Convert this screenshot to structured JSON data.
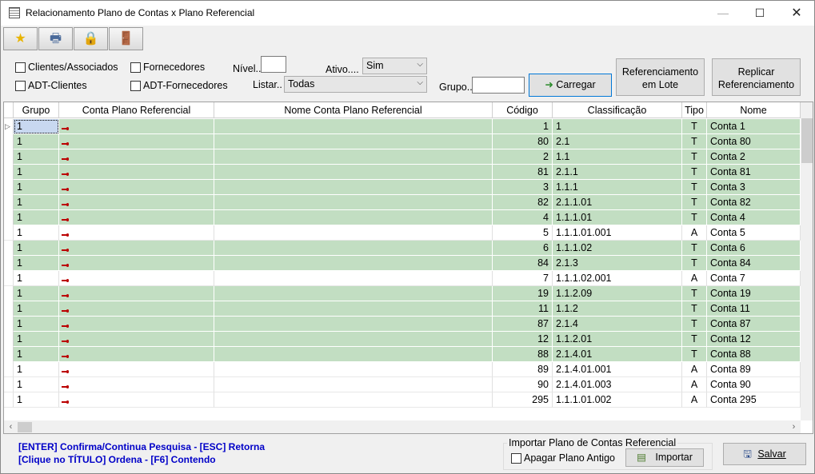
{
  "window": {
    "title": "Relacionamento Plano de Contas x Plano Referencial",
    "minimize": "—",
    "maximize": "☐",
    "close": "✕"
  },
  "toolbar": {
    "buttons": [
      {
        "icon": "star-icon",
        "glyph": "★"
      },
      {
        "icon": "printer-icon",
        "glyph": "🖶"
      },
      {
        "icon": "lock-icon",
        "glyph": "🔒"
      },
      {
        "icon": "exit-door-icon",
        "glyph": "🚪"
      }
    ]
  },
  "filters": {
    "clientes_associados": "Clientes/Associados",
    "fornecedores": "Fornecedores",
    "adt_clientes": "ADT-Clientes",
    "adt_fornecedores": "ADT-Fornecedores",
    "nivel_label": "Nível..",
    "nivel_value": "",
    "ativo_label": "Ativo....",
    "ativo_value": "Sim",
    "listar_label": "Listar..",
    "listar_value": "Todas",
    "grupo_label": "Grupo..",
    "grupo_value": "",
    "carregar_label": "Carregar",
    "ref_lote_line1": "Referenciamento",
    "ref_lote_line2": "em Lote",
    "replicar_line1": "Replicar",
    "replicar_line2": "Referenciamento"
  },
  "grid": {
    "columns": [
      "Grupo",
      "Conta Plano Referencial",
      "Nome Conta Plano Referencial",
      "Código",
      "Classificação",
      "Tipo",
      "Nome"
    ],
    "rows": [
      {
        "grupo": "1",
        "codigo": "1",
        "classificacao": "1",
        "tipo": "T",
        "nome": "Conta 1",
        "style": "green"
      },
      {
        "grupo": "1",
        "codigo": "80",
        "classificacao": "2.1",
        "tipo": "T",
        "nome": "Conta 80",
        "style": "green"
      },
      {
        "grupo": "1",
        "codigo": "2",
        "classificacao": "1.1",
        "tipo": "T",
        "nome": "Conta 2",
        "style": "green"
      },
      {
        "grupo": "1",
        "codigo": "81",
        "classificacao": "2.1.1",
        "tipo": "T",
        "nome": "Conta 81",
        "style": "green"
      },
      {
        "grupo": "1",
        "codigo": "3",
        "classificacao": "1.1.1",
        "tipo": "T",
        "nome": "Conta 3",
        "style": "green"
      },
      {
        "grupo": "1",
        "codigo": "82",
        "classificacao": "2.1.1.01",
        "tipo": "T",
        "nome": "Conta 82",
        "style": "green"
      },
      {
        "grupo": "1",
        "codigo": "4",
        "classificacao": "1.1.1.01",
        "tipo": "T",
        "nome": "Conta 4",
        "style": "green"
      },
      {
        "grupo": "1",
        "codigo": "5",
        "classificacao": "1.1.1.01.001",
        "tipo": "A",
        "nome": "Conta 5",
        "style": "white"
      },
      {
        "grupo": "1",
        "codigo": "6",
        "classificacao": "1.1.1.02",
        "tipo": "T",
        "nome": "Conta 6",
        "style": "green"
      },
      {
        "grupo": "1",
        "codigo": "84",
        "classificacao": "2.1.3",
        "tipo": "T",
        "nome": "Conta 84",
        "style": "green"
      },
      {
        "grupo": "1",
        "codigo": "7",
        "classificacao": "1.1.1.02.001",
        "tipo": "A",
        "nome": "Conta 7",
        "style": "white"
      },
      {
        "grupo": "1",
        "codigo": "19",
        "classificacao": "1.1.2.09",
        "tipo": "T",
        "nome": "Conta 19",
        "style": "green"
      },
      {
        "grupo": "1",
        "codigo": "11",
        "classificacao": "1.1.2",
        "tipo": "T",
        "nome": "Conta 11",
        "style": "green"
      },
      {
        "grupo": "1",
        "codigo": "87",
        "classificacao": "2.1.4",
        "tipo": "T",
        "nome": "Conta 87",
        "style": "green"
      },
      {
        "grupo": "1",
        "codigo": "12",
        "classificacao": "1.1.2.01",
        "tipo": "T",
        "nome": "Conta 12",
        "style": "green"
      },
      {
        "grupo": "1",
        "codigo": "88",
        "classificacao": "2.1.4.01",
        "tipo": "T",
        "nome": "Conta 88",
        "style": "green"
      },
      {
        "grupo": "1",
        "codigo": "89",
        "classificacao": "2.1.4.01.001",
        "tipo": "A",
        "nome": "Conta 89",
        "style": "white"
      },
      {
        "grupo": "1",
        "codigo": "90",
        "classificacao": "2.1.4.01.003",
        "tipo": "A",
        "nome": "Conta 90",
        "style": "white"
      },
      {
        "grupo": "1",
        "codigo": "295",
        "classificacao": "1.1.1.01.002",
        "tipo": "A",
        "nome": "Conta 295",
        "style": "white"
      }
    ]
  },
  "footer": {
    "help_line1": "[ENTER] Confirma/Continua Pesquisa - [ESC] Retorna",
    "help_line2": "[Clique no TÍTULO] Ordena - [F6] Contendo",
    "import_group_title": "Importar Plano de Contas Referencial",
    "apagar_label": "Apagar Plano Antigo",
    "importar_label": "Importar",
    "salvar_label": "Salvar"
  },
  "colors": {
    "row_green": "#c2dec2",
    "help_text": "#0000c8",
    "focus_border": "#0078d7"
  }
}
